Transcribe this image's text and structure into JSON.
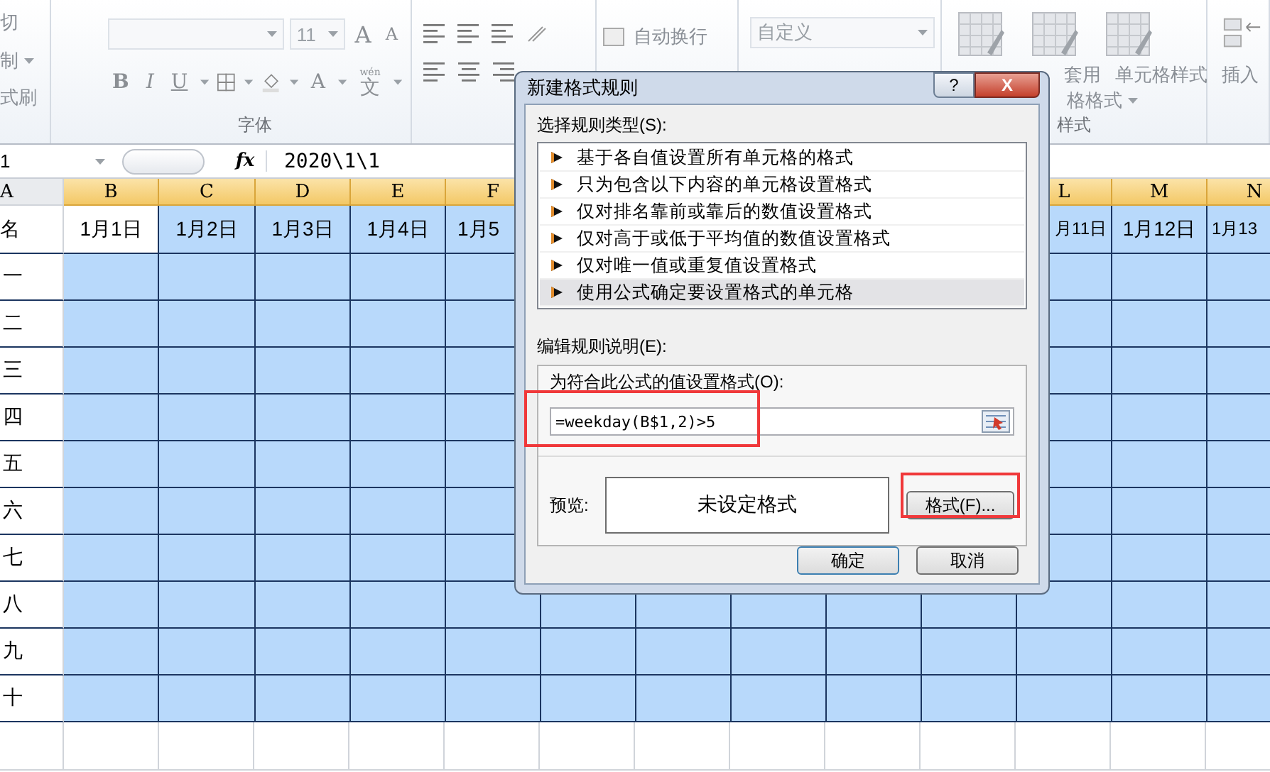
{
  "ribbon": {
    "clipboard": {
      "cut": "切",
      "copy": "制",
      "format_painter": "式刷"
    },
    "font": {
      "font_size": "11",
      "grow": "A",
      "shrink": "A",
      "bold": "B",
      "italic": "I",
      "underline": "U",
      "font_color": "A",
      "phonetic": "文",
      "phonetic_hint": "wén",
      "group_label": "字体"
    },
    "alignment": {
      "wrap_text": "自动换行"
    },
    "number": {
      "format": "自定义"
    },
    "styles": {
      "table_format": [
        "套用",
        "格格式"
      ],
      "cell_styles": "单元格样式",
      "group_label": "样式"
    },
    "cells": {
      "insert": "插入"
    }
  },
  "formula_bar": {
    "name_box": "1",
    "fx": "fx",
    "formula": "2020\\1\\1"
  },
  "sheet": {
    "left_columns": [
      "A",
      "B",
      "C",
      "D",
      "E",
      "F"
    ],
    "right_columns": [
      "L",
      "M",
      "N"
    ],
    "header_label": "名",
    "left_dates": [
      "1月1日",
      "1月2日",
      "1月3日",
      "1月4日",
      "1月5"
    ],
    "right_dates": [
      "月11日",
      "1月12日",
      "1月13"
    ],
    "rows": [
      "一",
      "二",
      "三",
      "四",
      "五",
      "六",
      "七",
      "八",
      "九",
      "十"
    ]
  },
  "dialog": {
    "title": "新建格式规则",
    "help": "?",
    "close": "X",
    "rule_type_label": "选择规则类型(S):",
    "rule_types": [
      {
        "label": "基于各自值设置所有单元格的格式",
        "selected": false
      },
      {
        "label": "只为包含以下内容的单元格设置格式",
        "selected": false
      },
      {
        "label": "仅对排名靠前或靠后的数值设置格式",
        "selected": false
      },
      {
        "label": "仅对高于或低于平均值的数值设置格式",
        "selected": false
      },
      {
        "label": "仅对唯一值或重复值设置格式",
        "selected": false
      },
      {
        "label": "使用公式确定要设置格式的单元格",
        "selected": true
      }
    ],
    "edit_label": "编辑规则说明(E):",
    "formula_label": "为符合此公式的值设置格式(O):",
    "formula": {
      "value": "=weekday(B$1,2)>5",
      "annotated": true
    },
    "preview_label": "预览:",
    "preview_text": "未设定格式",
    "format_button": {
      "label": "格式(F)...",
      "annotated": true
    },
    "ok": "确定",
    "cancel": "取消"
  }
}
